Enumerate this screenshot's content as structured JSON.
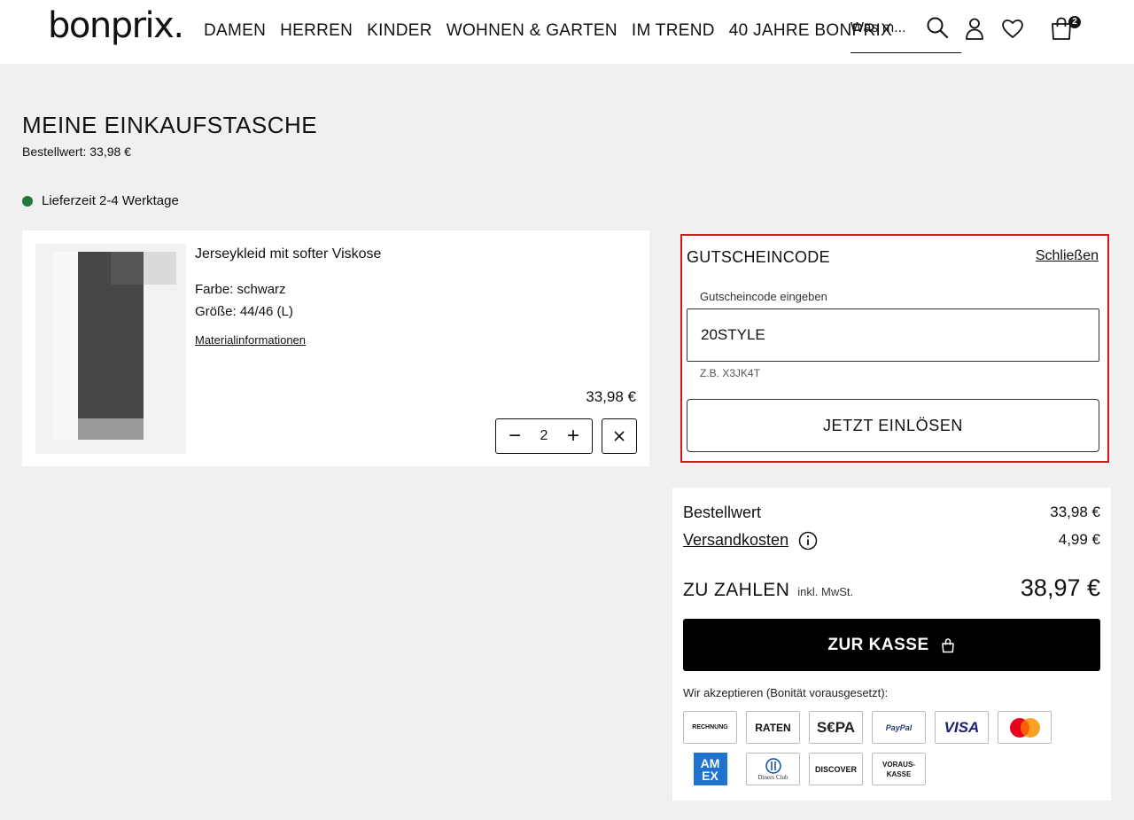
{
  "header": {
    "logo": "bonprix.",
    "nav": [
      "DAMEN",
      "HERREN",
      "KINDER",
      "WOHNEN & GARTEN",
      "IM TREND",
      "40 JAHRE BONPRIX"
    ],
    "search_placeholder": "Was m...",
    "cart_count": "2"
  },
  "page": {
    "title": "MEINE EINKAUFSTASCHE",
    "order_value_line": "Bestellwert: 33,98 €",
    "delivery": "Lieferzeit 2-4 Werktage"
  },
  "product": {
    "name": "Jerseykleid mit softer Viskose",
    "color": "Farbe: schwarz",
    "size": "Größe: 44/46 (L)",
    "material_link": "Materialinformationen",
    "price": "33,98 €",
    "quantity": "2",
    "minus_symbol": "−",
    "plus_symbol": "+"
  },
  "voucher": {
    "title": "GUTSCHEINCODE",
    "close": "Schließen",
    "label": "Gutscheincode eingeben",
    "value": "20STYLE",
    "hint": "Z.B. X3JK4T",
    "submit": "JETZT EINLÖSEN"
  },
  "summary": {
    "order_value_label": "Bestellwert",
    "order_value": "33,98 €",
    "shipping_label": "Versandkosten",
    "shipping": "4,99 €",
    "total_label": "ZU ZAHLEN",
    "total_note": "inkl. MwSt.",
    "total": "38,97 €",
    "checkout": "ZUR KASSE",
    "accept_text": "Wir akzeptieren (Bonität vorausgesetzt):"
  },
  "payment_methods": {
    "rechnung": "RECHNUNG",
    "raten": "RATEN",
    "sepa": "S€PA",
    "paypal": "PayPal",
    "visa": "VISA",
    "amex_line1": "AM",
    "amex_line2": "EX",
    "diners": "Diners Club",
    "discover": "DISCOVER",
    "vorauskasse_line1": "VORAUS-",
    "vorauskasse_line2": "KASSE"
  },
  "colors": {
    "accent_red": "#d9161c",
    "delivery_green": "#1f7a3e",
    "checkout_black": "#000000"
  },
  "icons": [
    "search-icon",
    "account-icon",
    "heart-icon",
    "bag-icon",
    "close-icon",
    "info-icon",
    "lock-bag-icon",
    "mastercard-icon"
  ]
}
